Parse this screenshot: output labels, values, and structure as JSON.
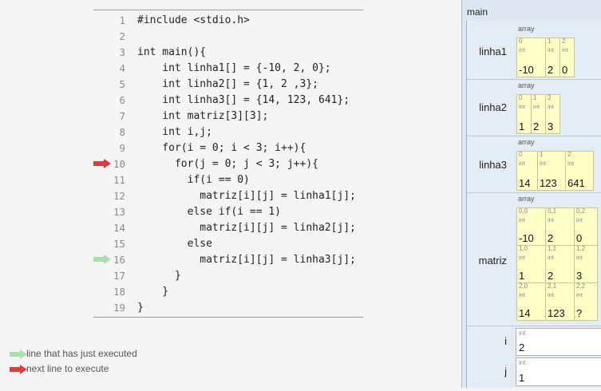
{
  "code": {
    "lines": [
      {
        "num": "1",
        "text": "#include <stdio.h>"
      },
      {
        "num": "2",
        "text": ""
      },
      {
        "num": "3",
        "text": "int main(){"
      },
      {
        "num": "4",
        "text": "    int linha1[] = {-10, 2, 0};"
      },
      {
        "num": "5",
        "text": "    int linha2[] = {1, 2 ,3};"
      },
      {
        "num": "6",
        "text": "    int linha3[] = {14, 123, 641};"
      },
      {
        "num": "7",
        "text": "    int matriz[3][3];"
      },
      {
        "num": "8",
        "text": "    int i,j;"
      },
      {
        "num": "9",
        "text": "    for(i = 0; i < 3; i++){"
      },
      {
        "num": "10",
        "text": "      for(j = 0; j < 3; j++){"
      },
      {
        "num": "11",
        "text": "        if(i == 0)"
      },
      {
        "num": "12",
        "text": "          matriz[i][j] = linha1[j];"
      },
      {
        "num": "13",
        "text": "        else if(i == 1)"
      },
      {
        "num": "14",
        "text": "          matriz[i][j] = linha2[j];"
      },
      {
        "num": "15",
        "text": "        else"
      },
      {
        "num": "16",
        "text": "          matriz[i][j] = linha3[j];"
      },
      {
        "num": "17",
        "text": "      }"
      },
      {
        "num": "18",
        "text": "    }"
      },
      {
        "num": "19",
        "text": "}"
      }
    ]
  },
  "arrows": {
    "next_line": "10",
    "just_executed": "16",
    "next_color": "#e03b3b",
    "executed_color": "#a8e0a8"
  },
  "legend": {
    "executed_label": "line that has just executed",
    "next_label": "next line to execute"
  },
  "memory": {
    "frame_name": "main",
    "array_label": "array",
    "type_label": "int",
    "linha1": {
      "name": "linha1",
      "indices": [
        "0",
        "1",
        "2"
      ],
      "values": [
        "-10",
        "2",
        "0"
      ]
    },
    "linha2": {
      "name": "linha2",
      "indices": [
        "0",
        "1",
        "2"
      ],
      "values": [
        "1",
        "2",
        "3"
      ]
    },
    "linha3": {
      "name": "linha3",
      "indices": [
        "0",
        "1",
        "2"
      ],
      "values": [
        "14",
        "123",
        "641"
      ]
    },
    "matriz": {
      "name": "matriz",
      "indices": [
        "0,0",
        "0,1",
        "0,2",
        "1,0",
        "1,1",
        "1,2",
        "2,0",
        "2,1",
        "2,2"
      ],
      "values": [
        "-10",
        "2",
        "0",
        "1",
        "2",
        "3",
        "14",
        "123",
        "?"
      ]
    },
    "i": {
      "name": "i",
      "value": "2"
    },
    "j": {
      "name": "j",
      "value": "1"
    }
  },
  "colors": {
    "cell_bg": "#ffffc6",
    "panel_bg": "#dde7f1"
  }
}
